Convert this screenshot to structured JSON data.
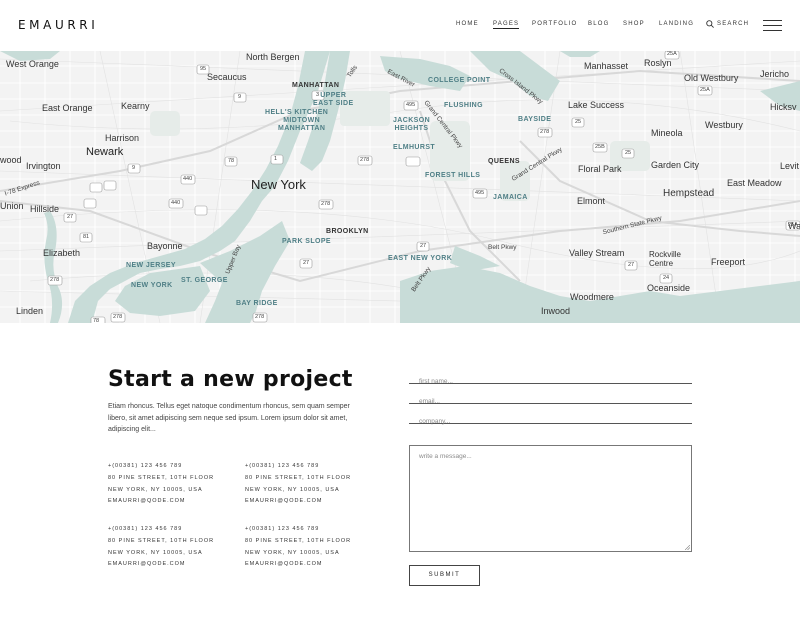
{
  "brand": {
    "logo": "EMAURRI"
  },
  "nav": {
    "items": [
      "HOME",
      "PAGES",
      "PORTFOLIO",
      "BLOG",
      "SHOP",
      "LANDING"
    ],
    "active": "PAGES",
    "search_label": "SEARCH"
  },
  "map": {
    "colors": {
      "land": "#f3f3f3",
      "water": "#c8dcd8",
      "road": "#ffffff",
      "park": "#e6ece9"
    },
    "places": {
      "west_orange": "West Orange",
      "north_bergen": "North Bergen",
      "secaucus": "Secaucus",
      "manhasset": "Manhasset",
      "roslyn": "Roslyn",
      "old_westbury": "Old Westbury",
      "jericho": "Jericho",
      "east_orange": "East Orange",
      "kearny": "Kearny",
      "lake_success": "Lake Success",
      "westbury": "Westbury",
      "hicksville": "Hicksv",
      "harrison": "Harrison",
      "newark": "Newark",
      "mineola": "Mineola",
      "wood": "wood",
      "irvington": "Irvington",
      "garden_city": "Garden City",
      "levitt": "Levit",
      "floral_park": "Floral Park",
      "new_york": "New York",
      "east_meadow": "East Meadow",
      "hempstead": "Hempstead",
      "union": "Union",
      "hillside": "Hillside",
      "elmont": "Elmont",
      "bayonne": "Bayonne",
      "elizabeth": "Elizabeth",
      "valley_stream": "Valley Stream",
      "rockville_centre": "Rockville\nCentre",
      "freeport": "Freeport",
      "oceanside": "Oceanside",
      "woodmere": "Woodmere",
      "linden": "Linden",
      "inwood": "Inwood",
      "wa": "Wa"
    },
    "districts": {
      "manhattan": "MANHATTAN",
      "upper_east_side": "UPPER\nEAST SIDE",
      "hells_kitchen": "HELL'S KITCHEN",
      "midtown": "MIDTOWN\nMANHATTAN",
      "college_point": "COLLEGE POINT",
      "flushing": "FLUSHING",
      "jackson_heights": "JACKSON\nHEIGHTS",
      "bayside": "BAYSIDE",
      "elmhurst": "ELMHURST",
      "queens": "QUEENS",
      "forest_hills": "FOREST HILLS",
      "jamaica": "JAMAICA",
      "brooklyn": "BROOKLYN",
      "park_slope": "PARK SLOPE",
      "new_jersey": "NEW JERSEY",
      "st_george": "ST. GEORGE",
      "new_york_district": "NEW YORK",
      "east_new_york": "EAST NEW YORK",
      "bay_ridge": "BAY RIDGE"
    },
    "roads": {
      "east_river": "East River",
      "grand_central": "Grand Central Pkwy",
      "grand_central_2": "Grand Central Pkwy",
      "cross_island": "Cross Island Pkwy",
      "upper_bay": "Upper Bay",
      "belt_pkwy": "Belt Pkwy",
      "belt_pkwy_2": "Belt Pkwy",
      "southern_state": "Southern State Pkwy",
      "i78_express": "I-78 Express",
      "tolls": "Tolls"
    },
    "shields": {
      "s95a": "95",
      "s9": "9",
      "s3": "3",
      "s495": "495",
      "s278a": "278",
      "s25": "25",
      "s278b": "278",
      "s1": "1",
      "s9b": "9",
      "s440": "440",
      "s78": "78",
      "s27": "27",
      "s81": "81",
      "s440b": "440",
      "s278c": "278",
      "s27b": "27",
      "s278d": "278",
      "s25a": "25A",
      "s25b": "25B",
      "s25c": "25",
      "s24": "24",
      "s27c": "27",
      "s27d": "27",
      "s1b": "1",
      "s278e": "278",
      "s9c": "9",
      "s495b": "495",
      "s278f": "278",
      "s25d": "25A",
      "s25e": "25A",
      "s78b": "78",
      "s27e": "27"
    }
  },
  "contact": {
    "title": "Start a new project",
    "description": "Etiam rhoncus. Tellus eget natoque condimentum rhoncus, sem quam semper libero, sit amet adipiscing sem neque sed ipsum. Lorem ipsum dolor sit amet, adipiscing elit...",
    "cards": [
      {
        "phone": "+(00381) 123 456 789",
        "street": "80 PINE STREET, 10TH FLOOR",
        "city": "NEW YORK, NY 10005, USA",
        "email": "EMAURRI@QODE.COM"
      },
      {
        "phone": "+(00381) 123 456 789",
        "street": "80 PINE STREET, 10TH FLOOR",
        "city": "NEW YORK, NY 10005, USA",
        "email": "EMAURRI@QODE.COM"
      },
      {
        "phone": "+(00381) 123 456 789",
        "street": "80 PINE STREET, 10TH FLOOR",
        "city": "NEW YORK, NY 10005, USA",
        "email": "EMAURRI@QODE.COM"
      },
      {
        "phone": "+(00381) 123 456 789",
        "street": "80 PINE STREET, 10TH FLOOR",
        "city": "NEW YORK, NY 10005, USA",
        "email": "EMAURRI@QODE.COM"
      }
    ]
  },
  "form": {
    "first_name_placeholder": "first name...",
    "email_placeholder": "email...",
    "company_placeholder": "company...",
    "message_placeholder": "write a message...",
    "submit_label": "SUBMIT"
  }
}
